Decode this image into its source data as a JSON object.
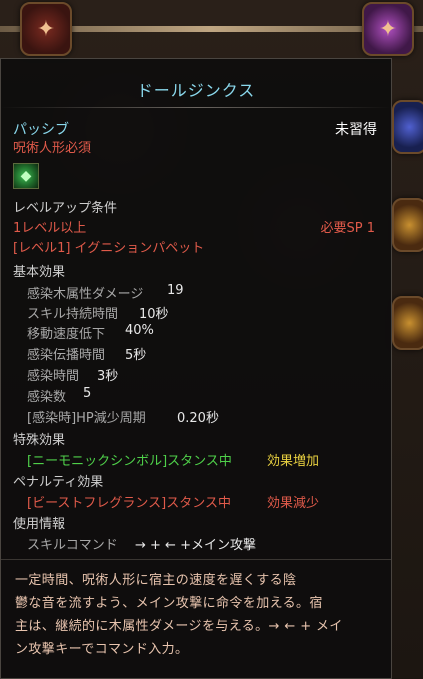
{
  "tooltip": {
    "title": "ドールジンクス",
    "type_label": "パッシブ",
    "status": "未習得",
    "requirement_item": "呪術人形必須",
    "skill_icon": "green-gem-icon",
    "levelup_header": "レベルアップ条件",
    "level_req": "1レベル以上",
    "sp_req": "必要SP 1",
    "prereq_skill": "[レベル1] イグニションパペット",
    "basic_effects_header": "基本効果",
    "basic_effects": [
      {
        "label": "感染木属性ダメージ",
        "value": "19"
      },
      {
        "label": "スキル持続時間",
        "value": "10秒"
      },
      {
        "label": "移動速度低下",
        "value": "40%"
      },
      {
        "label": "感染伝播時間",
        "value": "5秒"
      },
      {
        "label": "感染時間",
        "value": "3秒"
      },
      {
        "label": "感染数",
        "value": "5"
      },
      {
        "label": "[感染時]HP減少周期",
        "value": "0.20秒"
      }
    ],
    "special_header": "特殊効果",
    "special_text": "[ニーモニックシンボル]スタンス中",
    "special_result": "効果増加",
    "penalty_header": "ペナルティ効果",
    "penalty_text": "[ビーストフレグランス]スタンス中",
    "penalty_result": "効果減少",
    "usage_header": "使用情報",
    "command_label": "スキルコマンド",
    "command_value": "→ + ← +メイン攻撃",
    "description_lines": [
      "一定時間、呪術人形に宿主の速度を遅くする陰",
      "鬱な音を流すよう、メイン攻撃に命令を加える。宿",
      "主は、継続的に木属性ダメージを与える。→ ← + メイ",
      "ン攻撃キーでコマンド入力。"
    ]
  },
  "colors": {
    "title": "#8ad8ec",
    "warning": "#e05a4a",
    "positive": "#4fd04a",
    "effect_up": "#e8d040",
    "description": "#e8c4ae"
  }
}
